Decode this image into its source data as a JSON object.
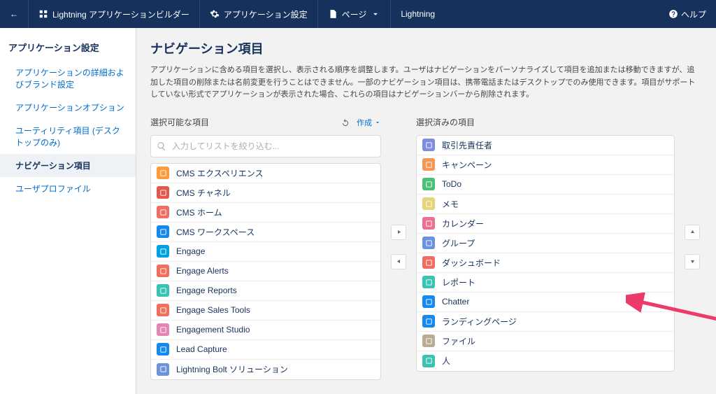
{
  "topbar": {
    "back": "←",
    "builder_label": "Lightning アプリケーションビルダー",
    "settings_label": "アプリケーション設定",
    "pages_label": "ページ",
    "app_name": "Lightning",
    "help_label": "ヘルプ"
  },
  "sidebar": {
    "title": "アプリケーション設定",
    "items": [
      {
        "label": "アプリケーションの詳細およびブランド設定"
      },
      {
        "label": "アプリケーションオプション"
      },
      {
        "label": "ユーティリティ項目 (デスクトップのみ)"
      },
      {
        "label": "ナビゲーション項目"
      },
      {
        "label": "ユーザプロファイル"
      }
    ],
    "active_index": 3
  },
  "page": {
    "title": "ナビゲーション項目",
    "description": "アプリケーションに含める項目を選択し、表示される順序を調整します。ユーザはナビゲーションをパーソナライズして項目を追加または移動できますが、追加した項目の削除または名前変更を行うことはできません。一部のナビゲーション項目は、携帯電話またはデスクトップでのみ使用できます。項目がサポートしていない形式でアプリケーションが表示された場合、これらの項目はナビゲーションバーから削除されます。"
  },
  "available": {
    "title": "選択可能な項目",
    "create_label": "作成",
    "search_placeholder": "入力してリストを絞り込む...",
    "items": [
      {
        "label": "CMS エクスペリエンス",
        "color": "#ff9a3c"
      },
      {
        "label": "CMS チャネル",
        "color": "#e2584d"
      },
      {
        "label": "CMS ホーム",
        "color": "#ef6e64"
      },
      {
        "label": "CMS ワークスペース",
        "color": "#1589ee"
      },
      {
        "label": "Engage",
        "color": "#00a1e0"
      },
      {
        "label": "Engage Alerts",
        "color": "#ef6e5c"
      },
      {
        "label": "Engage Reports",
        "color": "#3cc2b3"
      },
      {
        "label": "Engage Sales Tools",
        "color": "#ef6e5c"
      },
      {
        "label": "Engagement Studio",
        "color": "#e287b2"
      },
      {
        "label": "Lead Capture",
        "color": "#1589ee"
      },
      {
        "label": "Lightning Bolt ソリューション",
        "color": "#6b92dc"
      }
    ]
  },
  "selected": {
    "title": "選択済みの項目",
    "items": [
      {
        "label": "取引先責任者",
        "color": "#7f8de1"
      },
      {
        "label": "キャンペーン",
        "color": "#f49756"
      },
      {
        "label": "ToDo",
        "color": "#4bc076"
      },
      {
        "label": "メモ",
        "color": "#e6d478"
      },
      {
        "label": "カレンダー",
        "color": "#eb7092"
      },
      {
        "label": "グループ",
        "color": "#6b92dc"
      },
      {
        "label": "ダッシュボード",
        "color": "#ef6e64"
      },
      {
        "label": "レポート",
        "color": "#3cc2b3"
      },
      {
        "label": "Chatter",
        "color": "#1589ee"
      },
      {
        "label": "ランディングページ",
        "color": "#1589ee"
      },
      {
        "label": "ファイル",
        "color": "#baac93"
      },
      {
        "label": "人",
        "color": "#3cc2b3"
      }
    ]
  }
}
